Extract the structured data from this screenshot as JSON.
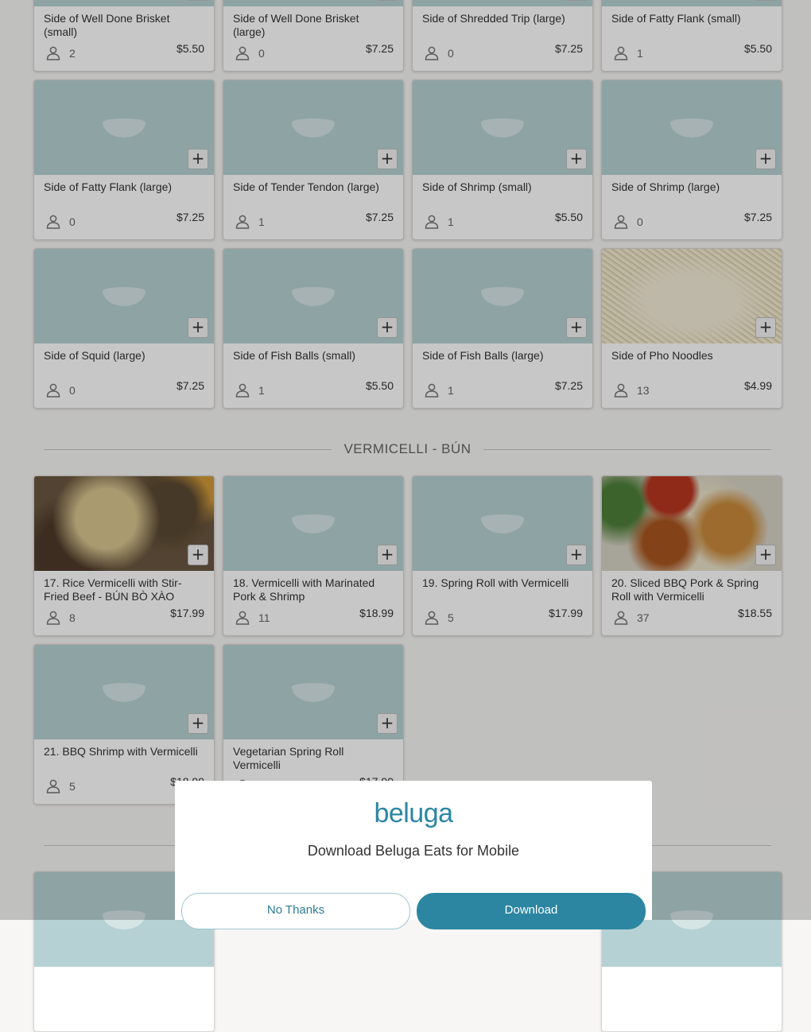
{
  "rows": [
    {
      "items": [
        {
          "name": "Side of Well Done Brisket (small)",
          "count": "2",
          "price": "$5.50"
        },
        {
          "name": "Side of Well Done Brisket (large)",
          "count": "0",
          "price": "$7.25"
        },
        {
          "name": "Side of Shredded Trip (large)",
          "count": "0",
          "price": "$7.25"
        },
        {
          "name": "Side of Fatty Flank (small)",
          "count": "1",
          "price": "$5.50"
        }
      ]
    },
    {
      "items": [
        {
          "name": "Side of Fatty Flank (large)",
          "count": "0",
          "price": "$7.25"
        },
        {
          "name": "Side of Tender Tendon (large)",
          "count": "1",
          "price": "$7.25"
        },
        {
          "name": "Side of Shrimp (small)",
          "count": "1",
          "price": "$5.50"
        },
        {
          "name": "Side of Shrimp (large)",
          "count": "0",
          "price": "$7.25"
        }
      ]
    },
    {
      "items": [
        {
          "name": "Side of Squid (large)",
          "count": "0",
          "price": "$7.25"
        },
        {
          "name": "Side of Fish Balls (small)",
          "count": "1",
          "price": "$5.50"
        },
        {
          "name": "Side of Fish Balls (large)",
          "count": "1",
          "price": "$7.25"
        },
        {
          "name": "Side of Pho Noodles",
          "count": "13",
          "price": "$4.99",
          "image": "noodles"
        }
      ]
    }
  ],
  "section_vermicelli": {
    "title": "VERMICELLI - BÚN",
    "items": [
      {
        "name": "17. Rice Vermicelli with Stir-Fried Beef - BÚN BÒ XÀO",
        "count": "8",
        "price": "$17.99",
        "image": "bunbo"
      },
      {
        "name": "18. Vermicelli with Marinated Pork & Shrimp",
        "count": "11",
        "price": "$18.99"
      },
      {
        "name": "19. Spring Roll with Vermicelli",
        "count": "5",
        "price": "$17.99"
      },
      {
        "name": "20. Sliced BBQ Pork & Spring Roll with Vermicelli",
        "count": "37",
        "price": "$18.55",
        "image": "bbq"
      },
      {
        "name": "21. BBQ Shrimp with Vermicelli",
        "count": "5",
        "price": "$18.99"
      },
      {
        "name": "Vegetarian Spring Roll Vermicelli",
        "count": "",
        "price": "$17.99"
      }
    ]
  },
  "icons": {
    "add": "plus-icon",
    "person": "person-icon",
    "placeholder": "beluga-placeholder-icon"
  },
  "modal": {
    "logo": "beluga",
    "message": "Download Beluga Eats for Mobile",
    "no_thanks": "No Thanks",
    "download": "Download"
  },
  "colors": {
    "accent": "#2c86a1",
    "placeholder": "#b6d1d3",
    "background": "#f7f6f4"
  }
}
